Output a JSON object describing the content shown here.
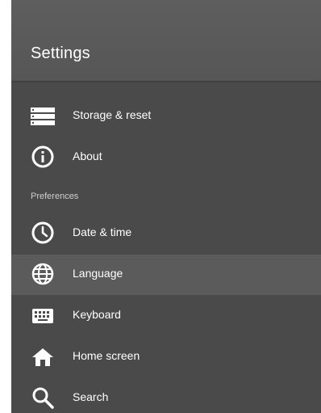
{
  "header": {
    "title": "Settings"
  },
  "list": {
    "items": [
      {
        "label": "",
        "icon": "partial-icon"
      },
      {
        "label": "Storage & reset",
        "icon": "storage-icon"
      },
      {
        "label": "About",
        "icon": "info-icon"
      },
      {
        "label": "Date & time",
        "icon": "clock-icon"
      },
      {
        "label": "Language",
        "icon": "globe-icon",
        "selected": true
      },
      {
        "label": "Keyboard",
        "icon": "keyboard-icon"
      },
      {
        "label": "Home screen",
        "icon": "home-icon"
      },
      {
        "label": "Search",
        "icon": "search-icon"
      }
    ],
    "sections": [
      {
        "label": "Preferences"
      }
    ]
  },
  "colors": {
    "background": "#4a4a4a",
    "header": "#5a5a5a",
    "selected_row": "#5b5b5b",
    "text": "#ffffff",
    "section_text": "#cfcfcf"
  }
}
